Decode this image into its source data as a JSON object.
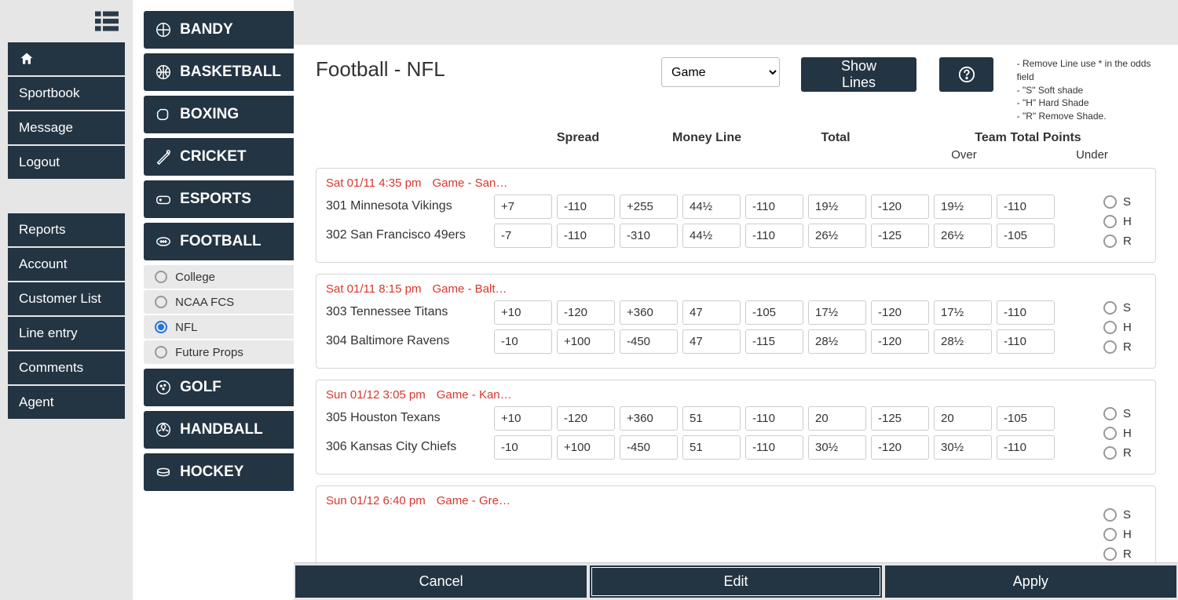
{
  "nav_primary": {
    "home": "",
    "items": [
      "Sportbook",
      "Message",
      "Logout"
    ]
  },
  "nav_secondary": [
    "Reports",
    "Account",
    "Customer List",
    "Line entry",
    "Comments",
    "Agent"
  ],
  "sports": [
    {
      "name": "BANDY"
    },
    {
      "name": "BASKETBALL"
    },
    {
      "name": "BOXING"
    },
    {
      "name": "CRICKET"
    },
    {
      "name": "ESPORTS"
    },
    {
      "name": "FOOTBALL",
      "expanded": true,
      "subs": [
        {
          "label": "College",
          "selected": false
        },
        {
          "label": "NCAA FCS",
          "selected": false
        },
        {
          "label": "NFL",
          "selected": true
        },
        {
          "label": "Future Props",
          "selected": false
        }
      ]
    },
    {
      "name": "GOLF"
    },
    {
      "name": "HANDBALL"
    },
    {
      "name": "HOCKEY"
    }
  ],
  "page_title": "Football - NFL",
  "line_type_selected": "Game",
  "show_lines_label": "Show Lines",
  "help_tips": [
    "- Remove Line use * in the odds field",
    "- \"S\" Soft shade",
    "- \"H\" Hard Shade",
    "- \"R\" Remove Shade."
  ],
  "col_headers": {
    "spread": "Spread",
    "moneyline": "Money Line",
    "total": "Total",
    "team_total": "Team Total Points",
    "over": "Over",
    "under": "Under"
  },
  "shade_labels": {
    "s": "S",
    "h": "H",
    "r": "R"
  },
  "games": [
    {
      "time": "Sat 01/11 4:35 pm",
      "loc": "Game - San …",
      "away": {
        "rot": "301",
        "name": "Minnesota Vikings",
        "spread": "+7",
        "spread_odds": "-110",
        "ml": "+255",
        "total": "44½",
        "total_odds": "-110",
        "tt": "19½",
        "tt_over": "-120",
        "tt2": "19½",
        "tt_under": "-110"
      },
      "home": {
        "rot": "302",
        "name": "San Francisco 49ers",
        "spread": "-7",
        "spread_odds": "-110",
        "ml": "-310",
        "total": "44½",
        "total_odds": "-110",
        "tt": "26½",
        "tt_over": "-125",
        "tt2": "26½",
        "tt_under": "-105"
      }
    },
    {
      "time": "Sat 01/11 8:15 pm",
      "loc": "Game - Balt…",
      "away": {
        "rot": "303",
        "name": "Tennessee Titans",
        "spread": "+10",
        "spread_odds": "-120",
        "ml": "+360",
        "total": "47",
        "total_odds": "-105",
        "tt": "17½",
        "tt_over": "-120",
        "tt2": "17½",
        "tt_under": "-110"
      },
      "home": {
        "rot": "304",
        "name": "Baltimore Ravens",
        "spread": "-10",
        "spread_odds": "+100",
        "ml": "-450",
        "total": "47",
        "total_odds": "-115",
        "tt": "28½",
        "tt_over": "-120",
        "tt2": "28½",
        "tt_under": "-110"
      }
    },
    {
      "time": "Sun 01/12 3:05 pm",
      "loc": "Game - Kan…",
      "away": {
        "rot": "305",
        "name": "Houston Texans",
        "spread": "+10",
        "spread_odds": "-120",
        "ml": "+360",
        "total": "51",
        "total_odds": "-110",
        "tt": "20",
        "tt_over": "-125",
        "tt2": "20",
        "tt_under": "-105"
      },
      "home": {
        "rot": "306",
        "name": "Kansas City Chiefs",
        "spread": "-10",
        "spread_odds": "+100",
        "ml": "-450",
        "total": "51",
        "total_odds": "-110",
        "tt": "30½",
        "tt_over": "-120",
        "tt2": "30½",
        "tt_under": "-110"
      }
    },
    {
      "time": "Sun 01/12 6:40 pm",
      "loc": "Game - Gre…",
      "away": {
        "rot": "",
        "name": "",
        "spread": "",
        "spread_odds": "",
        "ml": "",
        "total": "",
        "total_odds": "",
        "tt": "",
        "tt_over": "",
        "tt2": "",
        "tt_under": ""
      },
      "home": {
        "rot": "",
        "name": "",
        "spread": "",
        "spread_odds": "",
        "ml": "",
        "total": "",
        "total_odds": "",
        "tt": "",
        "tt_over": "",
        "tt2": "",
        "tt_under": ""
      }
    }
  ],
  "footer": {
    "cancel": "Cancel",
    "edit": "Edit",
    "apply": "Apply"
  }
}
